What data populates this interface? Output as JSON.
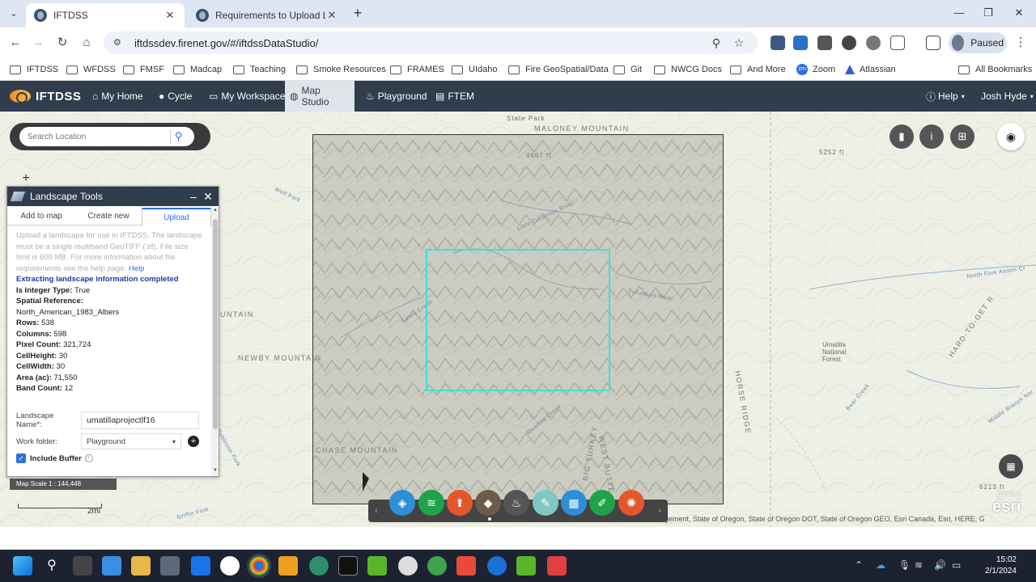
{
  "browser": {
    "tabs": [
      {
        "title": "IFTDSS",
        "active": true
      },
      {
        "title": "Requirements to Upload Lands",
        "active": false
      }
    ],
    "url": "iftdssdev.firenet.gov/#/iftdssDataStudio/",
    "profile_label": "Paused",
    "bookmarks": [
      "IFTDSS",
      "WFDSS",
      "FMSF",
      "Madcap",
      "Teaching",
      "Smoke Resources",
      "FRAMES",
      "UIdaho",
      "Fire GeoSpatial/Data",
      "Git",
      "NWCG Docs",
      "And More",
      "Zoom",
      "Atlassian",
      "All Bookmarks"
    ]
  },
  "app": {
    "logo": "IFTDSS",
    "nav": [
      "My Home",
      "Cycle",
      "My Workspace",
      "Map Studio",
      "Playground",
      "FTEM"
    ],
    "active_nav": "Map Studio",
    "help": "Help",
    "user": "Josh Hyde"
  },
  "map": {
    "search_placeholder": "Search Location",
    "labels": {
      "maloney": "MALONEY MOUNTAIN",
      "state_park": "State Park",
      "elev1": "4667 ft",
      "elev2": "5252 ft",
      "elev3": "6213 ft",
      "newby": "NEWBY MOUNTAIN",
      "chase": "CHASE MOUNTAIN",
      "horse_ridge": "HORSE RIDGE",
      "hard_to_get": "HARD-TO-GET R",
      "umatilla": "Umatilla National Forest",
      "tucannon": "Tucannon River",
      "little_tucannon": "Little Tucannon River",
      "nf_asotin": "North Fork Asotin Cr",
      "middle_branch": "Middle Branch Nor",
      "bear_creek": "Bear Creek",
      "big_turkey": "BIG TURKEY",
      "west_butte": "WEST BUTTE",
      "meadow_creek": "Meadow Creek",
      "wolf_fork": "Wolf Fork",
      "lewis_creek": "Lewis Creek",
      "griffin_fork": "Griffin Fork",
      "robinson_fork": "Robinson Fork",
      "untain": "UNTAIN"
    },
    "scale_text": "Map Scale 1 : 144,448",
    "scale_bar_label": "2mi",
    "attribution": "agement, State of Oregon, State of Oregon DOT, State of Oregon GEO, Esri Canada, Esri, HERE, Garm...",
    "esri_powered": "POWERED BY",
    "esri": "esri"
  },
  "panel": {
    "title": "Landscape Tools",
    "tabs": [
      "Add to map",
      "Create new",
      "Upload"
    ],
    "active_tab": "Upload",
    "intro": "Upload a landscape for use in IFTDSS. The landscape must be a single multiband GeoTIFF (.tif). File size limit is 600 MB. For more information about file requirements see the help page:",
    "help_link": "Help",
    "status": "Extracting landscape information completed",
    "fields": [
      {
        "label": "Is Integer Type:",
        "value": "True"
      },
      {
        "label": "Spatial Reference:",
        "value": ""
      },
      {
        "label": "",
        "value": "North_American_1983_Albers"
      },
      {
        "label": "Rows:",
        "value": "538"
      },
      {
        "label": "Columns:",
        "value": "598"
      },
      {
        "label": "Pixel Count:",
        "value": "321,724"
      },
      {
        "label": "CellHeight:",
        "value": "30"
      },
      {
        "label": "CellWidth:",
        "value": "30"
      },
      {
        "label": "Area (ac):",
        "value": "71,550"
      },
      {
        "label": "Band Count:",
        "value": "12"
      }
    ],
    "name_label": "Landscape Name*:",
    "name_value": "umatillaprojectlf16",
    "folder_label": "Work folder:",
    "folder_value": "Playground",
    "buffer_label": "Include Buffer"
  },
  "taskbar": {
    "time": "15:02",
    "date": "2/1/2024"
  },
  "colors": {
    "app_header": "#2f3d4d",
    "aoi_outline": "#3fe0d8",
    "status_text": "#1a3ca8",
    "link": "#2d6fe0"
  }
}
